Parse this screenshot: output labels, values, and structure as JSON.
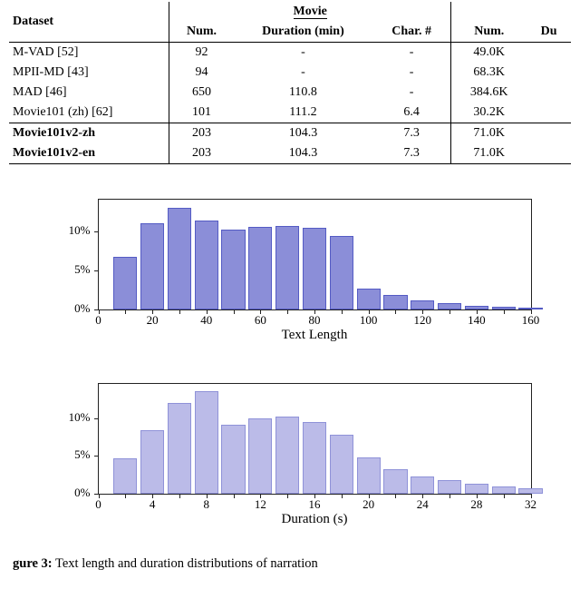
{
  "table": {
    "header_dataset": "Dataset",
    "group_movie": "Movie",
    "cols": [
      "Num.",
      "Duration (min)",
      "Char. #",
      "Num.",
      "Du"
    ],
    "rows": [
      {
        "name": "M-VAD [52]",
        "num": "92",
        "dur": "-",
        "char": "-",
        "num2": "49.0K"
      },
      {
        "name": "MPII-MD [43]",
        "num": "94",
        "dur": "-",
        "char": "-",
        "num2": "68.3K"
      },
      {
        "name": "MAD [46]",
        "num": "650",
        "dur": "110.8",
        "char": "-",
        "num2": "384.6K"
      },
      {
        "name": "Movie101 (zh) [62]",
        "num": "101",
        "dur": "111.2",
        "char": "6.4",
        "num2": "30.2K"
      }
    ],
    "rows_bold": [
      {
        "name": "Movie101v2-zh",
        "num": "203",
        "dur": "104.3",
        "char": "7.3",
        "num2": "71.0K"
      },
      {
        "name": "Movie101v2-en",
        "num": "203",
        "dur": "104.3",
        "char": "7.3",
        "num2": "71.0K"
      }
    ]
  },
  "chart_data": [
    {
      "type": "bar",
      "title": "",
      "xlabel": "Text Length",
      "ylabel": "",
      "yticks": [
        0,
        5,
        10
      ],
      "yticklabels": [
        "0%",
        "5%",
        "10%"
      ],
      "ylim": [
        0,
        14
      ],
      "x": [
        0,
        10,
        20,
        30,
        40,
        50,
        60,
        70,
        80,
        90,
        100,
        110,
        120,
        130,
        140,
        150,
        160
      ],
      "xticklabels": [
        "0",
        "",
        "20",
        "",
        "40",
        "",
        "60",
        "",
        "80",
        "",
        "100",
        "",
        "120",
        "",
        "140",
        "",
        "160"
      ],
      "values": [
        0,
        6.7,
        11.0,
        13.0,
        11.3,
        10.2,
        10.5,
        10.6,
        10.4,
        9.4,
        2.7,
        1.8,
        1.2,
        0.8,
        0.5,
        0.3,
        0.1
      ],
      "barColor": "#8b8ed8"
    },
    {
      "type": "bar",
      "title": "",
      "xlabel": "Duration (s)",
      "ylabel": "",
      "yticks": [
        0,
        5,
        10
      ],
      "yticklabels": [
        "0%",
        "5%",
        "10%"
      ],
      "ylim": [
        0,
        14.5
      ],
      "x": [
        0,
        2,
        4,
        6,
        8,
        10,
        12,
        14,
        16,
        18,
        20,
        22,
        24,
        26,
        28,
        30,
        32
      ],
      "xticklabels": [
        "0",
        "",
        "4",
        "",
        "8",
        "",
        "12",
        "",
        "16",
        "",
        "20",
        "",
        "24",
        "",
        "28",
        "",
        "32"
      ],
      "values": [
        0,
        4.7,
        8.4,
        12.0,
        13.5,
        9.1,
        10.0,
        10.2,
        9.5,
        7.8,
        4.8,
        3.2,
        2.3,
        1.8,
        1.3,
        1.0,
        0.7
      ],
      "barColor": "#bbbbe8"
    }
  ],
  "caption_lead": "gure 3:",
  "caption_rest": " Text length and duration distributions of narration"
}
